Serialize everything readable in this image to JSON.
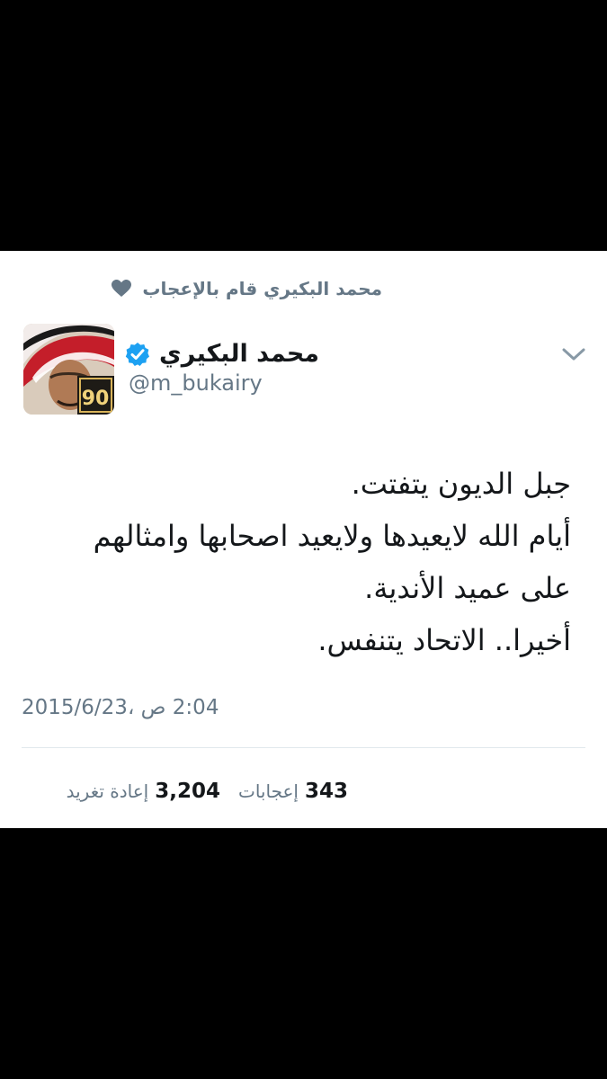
{
  "context": {
    "label": "محمد البكيري قام بالإعجاب",
    "icon": "heart-icon"
  },
  "author": {
    "display_name": "محمد البكيري",
    "handle": "@m_bukairy",
    "verified": true,
    "verified_icon": "verified-badge-icon",
    "avatar_badge_text": "90"
  },
  "menu": {
    "icon": "chevron-down-icon"
  },
  "tweet": {
    "lines": [
      "جبل الديون يتفتت.",
      "أيام الله لايعيدها ولايعيد اصحابها وامثالهم",
      "على عميد الأندية.",
      "أخيرا.. الاتحاد يتنفس."
    ],
    "timestamp": "2:04 ص ،2015/6/23"
  },
  "stats": {
    "likes_count": "343",
    "likes_label": "إعجابات",
    "retweets_count": "3,204",
    "retweets_label": "إعادة تغريد"
  },
  "colors": {
    "background": "#000000",
    "card": "#ffffff",
    "text_primary": "#14171a",
    "text_secondary": "#657786",
    "verified_blue": "#1da1f2",
    "divider": "#e1e8ed"
  }
}
